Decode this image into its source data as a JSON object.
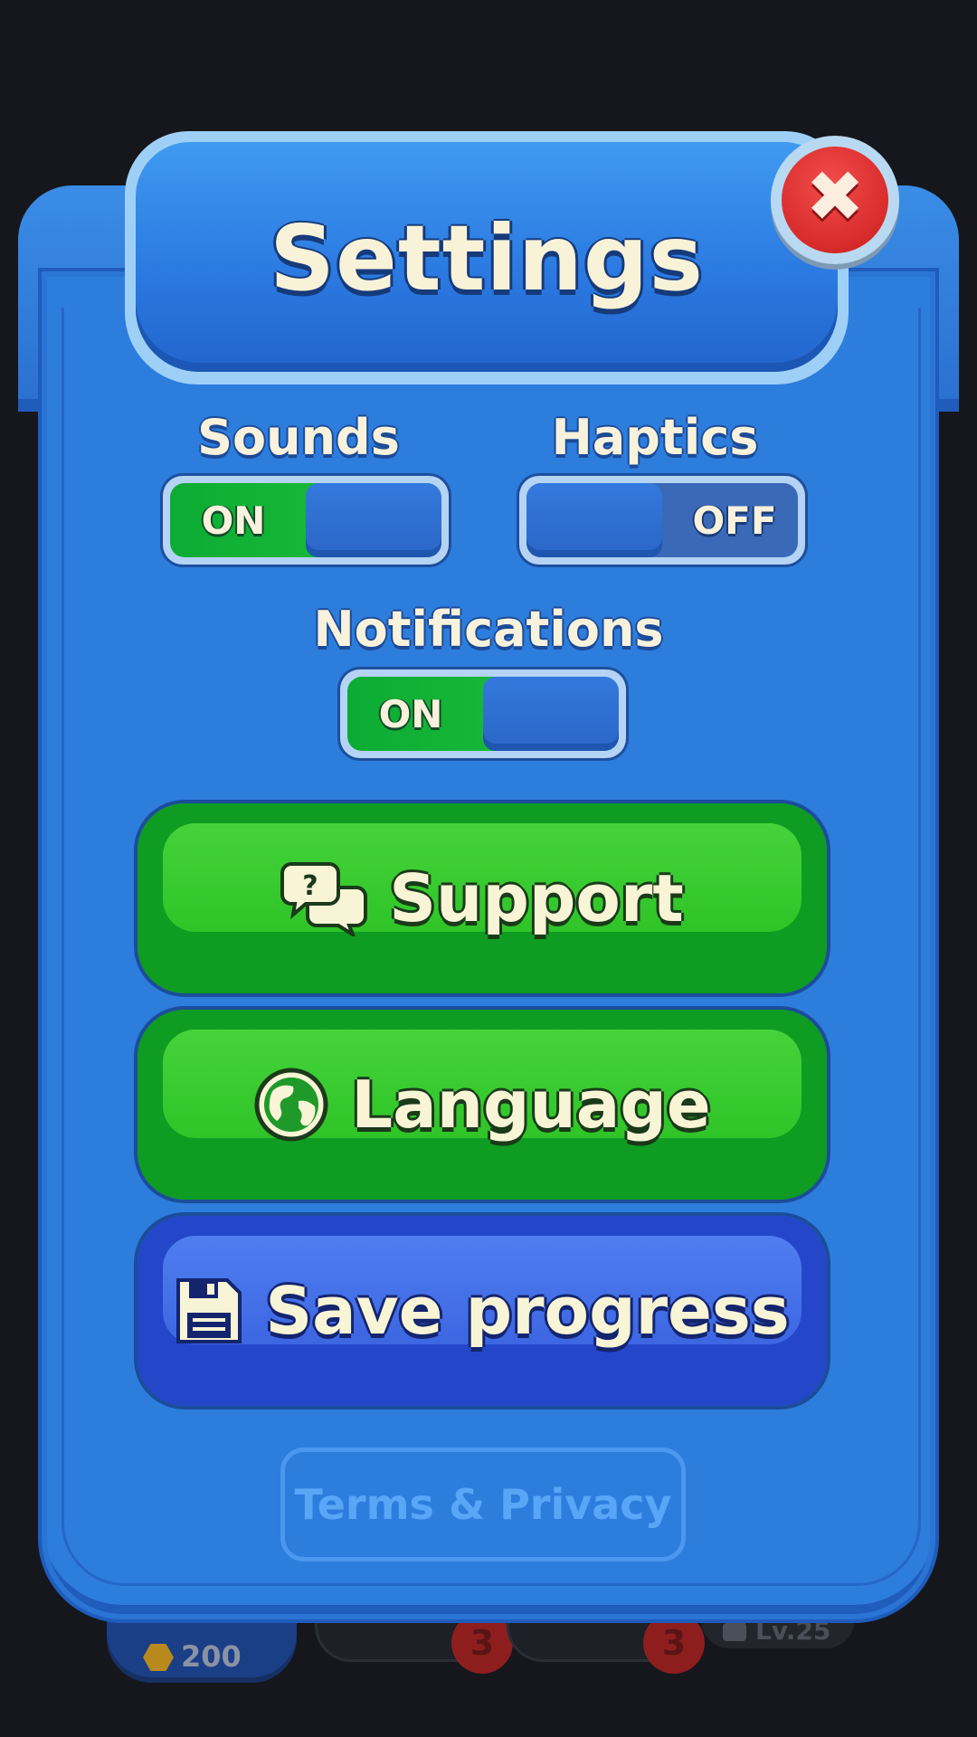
{
  "title": "Settings",
  "close": {
    "icon": "close-icon",
    "color": "#d82b2b"
  },
  "toggles": {
    "sounds": {
      "label": "Sounds",
      "state": "ON",
      "on": true
    },
    "haptics": {
      "label": "Haptics",
      "state": "OFF",
      "on": false
    },
    "notifications": {
      "label": "Notifications",
      "state": "ON",
      "on": true
    }
  },
  "buttons": {
    "support": {
      "label": "Support",
      "icon": "chat-question-icon",
      "color": "#2fc428"
    },
    "language": {
      "label": "Language",
      "icon": "globe-icon",
      "color": "#2fc428"
    },
    "save": {
      "label": "Save progress",
      "icon": "floppy-disk-icon",
      "color": "#3d66e2"
    }
  },
  "terms_label": "Terms & Privacy",
  "hud": {
    "coins": "200",
    "slot_badges": [
      "3",
      "3"
    ],
    "locked_level": "Lv.25"
  }
}
